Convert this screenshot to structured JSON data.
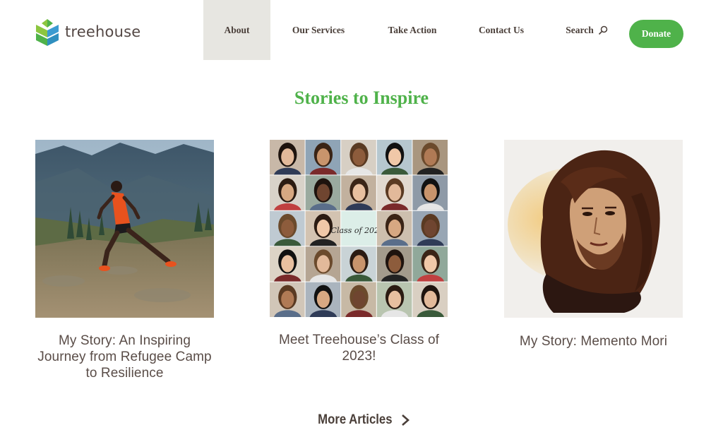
{
  "brand": {
    "name": "treehouse"
  },
  "nav": {
    "about": "About",
    "services": "Our Services",
    "action": "Take Action",
    "contact": "Contact Us",
    "search": "Search",
    "donate": "Donate"
  },
  "section": {
    "title": "Stories to Inspire"
  },
  "cards": [
    {
      "title": "My Story: An Inspiring Journey from Refugee Camp to Resilience"
    },
    {
      "title": "Meet Treehouse’s Class of 2023!",
      "image_caption": "Class of 2023!"
    },
    {
      "title": "My Story: Memento Mori"
    }
  ],
  "more": {
    "label": "More Articles"
  },
  "colors": {
    "accent": "#4fb24a",
    "text": "#4a3f39",
    "active_nav_bg": "#e7e6e1"
  }
}
